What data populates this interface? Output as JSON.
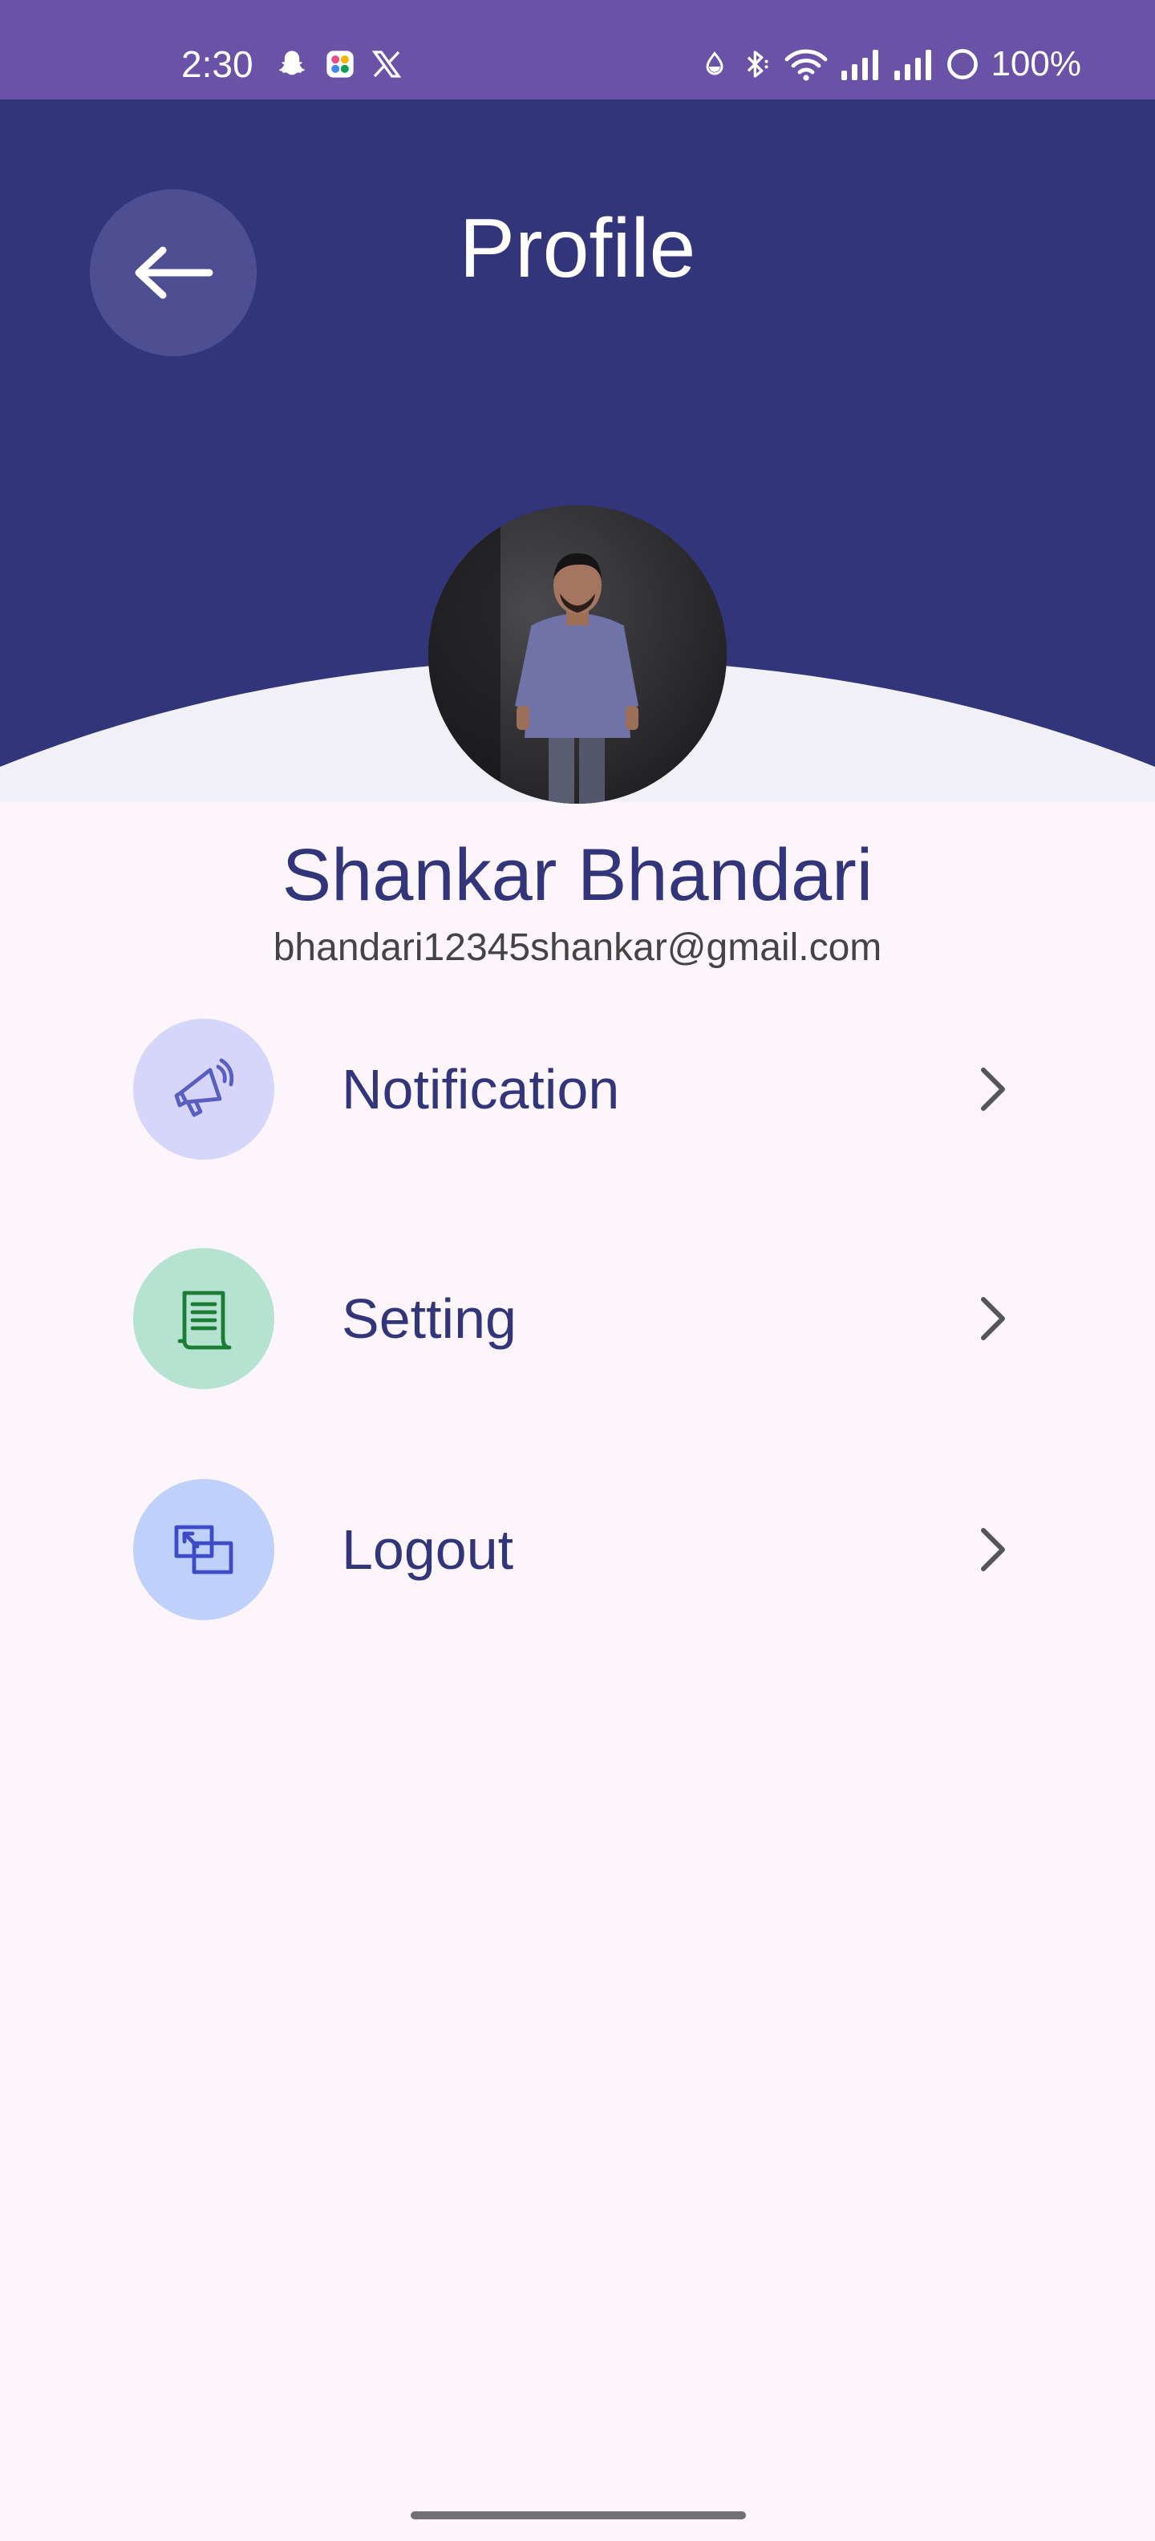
{
  "status_bar": {
    "time": "2:30",
    "left_icons": [
      "snapchat-icon",
      "multi-app-icon",
      "x-icon"
    ],
    "right_icons": [
      "data-saver-icon",
      "bluetooth-icon",
      "wifi-icon",
      "signal-icon",
      "signal-icon",
      "battery-icon"
    ],
    "battery_percent": "100%"
  },
  "header": {
    "title": "Profile",
    "background_color": "#32357a",
    "back_icon": "arrow-left-icon"
  },
  "profile": {
    "name": "Shankar Bhandari",
    "email": "bhandari12345shankar@gmail.com",
    "avatar": "profile-photo"
  },
  "menu": {
    "items": [
      {
        "label": "Notification",
        "icon": "megaphone-icon",
        "icon_bg": "#d6d6fb",
        "icon_color": "#5a5ec0"
      },
      {
        "label": "Setting",
        "icon": "document-scroll-icon",
        "icon_bg": "#b6e3d1",
        "icon_color": "#1b7d35"
      },
      {
        "label": "Logout",
        "icon": "logout-windows-icon",
        "icon_bg": "#bfd0fa",
        "icon_color": "#3e4ac6"
      }
    ]
  },
  "colors": {
    "status_bar": "#6a52a6",
    "page_background": "#fcf5fc",
    "text_primary": "#32357a",
    "text_secondary": "#444444",
    "chevron": "#555555"
  }
}
